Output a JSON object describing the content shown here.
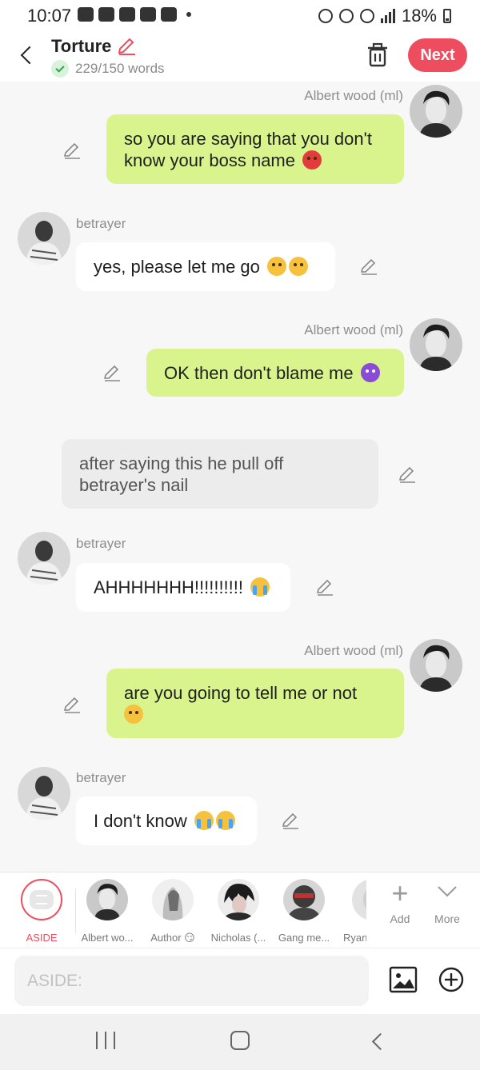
{
  "status_bar": {
    "time": "10:07",
    "battery": "18%"
  },
  "header": {
    "title": "Torture",
    "word_count": "229/150 words",
    "next_label": "Next"
  },
  "messages": [
    {
      "sender": "Albert wood (ml)",
      "text": "so you are saying that you don't know your boss name",
      "emoji": "angry"
    },
    {
      "sender": "betrayer",
      "text": "yes,  please let me go",
      "emoji": "sad"
    },
    {
      "sender": "Albert wood (ml)",
      "text": "OK then don't blame me",
      "emoji": "devil"
    },
    {
      "sender": "",
      "text": "after saying this he pull off betrayer's nail"
    },
    {
      "sender": "betrayer",
      "text": "AHHHHHHH!!!!!!!!!!",
      "emoji": "cry"
    },
    {
      "sender": "Albert wood (ml)",
      "text": "are you going to tell me or not",
      "emoji": "smirk"
    },
    {
      "sender": "betrayer",
      "text": "I don't know",
      "emoji": "cry"
    }
  ],
  "characters": [
    {
      "label": "ASIDE"
    },
    {
      "label": "Albert wo..."
    },
    {
      "label": "Author 😏"
    },
    {
      "label": "Nicholas (..."
    },
    {
      "label": "Gang me..."
    },
    {
      "label": "Ryan"
    }
  ],
  "tools": {
    "add": "Add",
    "more": "More"
  },
  "input": {
    "placeholder": "ASIDE:"
  }
}
